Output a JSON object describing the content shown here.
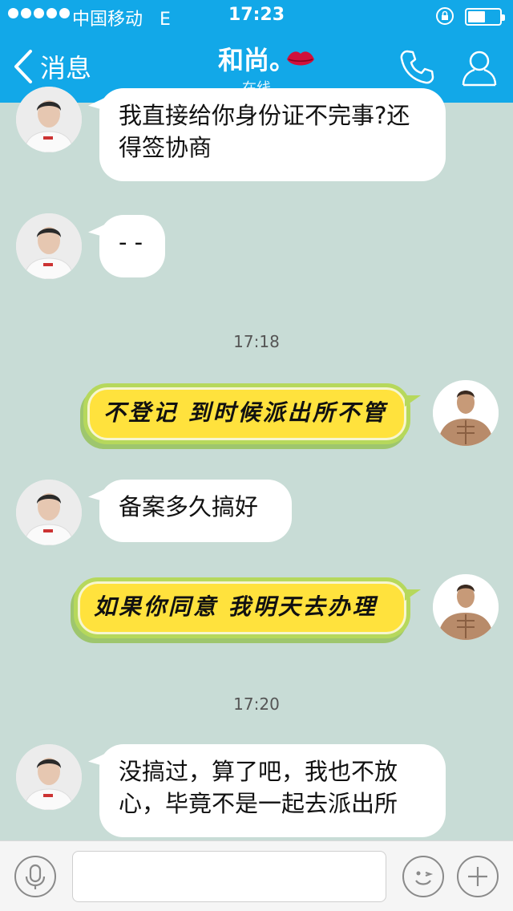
{
  "status_bar": {
    "carrier": "中国移动",
    "network": "E",
    "time": "17:23",
    "battery_level": 0.55
  },
  "nav": {
    "back_label": "消息",
    "title": "和尚。",
    "subtitle": "在线"
  },
  "messages": [
    {
      "from": "contact",
      "text": "我直接给你身份证不完事?还得签协商"
    },
    {
      "from": "contact",
      "text": "- -"
    },
    {
      "type": "timestamp",
      "text": "17:18"
    },
    {
      "from": "me",
      "text": "不登记 到时候派出所不管"
    },
    {
      "from": "contact",
      "text": "备案多久搞好"
    },
    {
      "from": "me",
      "text": "如果你同意 我明天去办理"
    },
    {
      "type": "timestamp",
      "text": "17:20"
    },
    {
      "from": "contact",
      "text": "没搞过，算了吧，我也不放心，毕竟不是一起去派出所"
    }
  ],
  "input": {
    "placeholder": "",
    "value": ""
  },
  "colors": {
    "nav_bg": "#12a8e8",
    "chat_bg": "#c8dcd6",
    "bubble_yellow": "#ffe23d",
    "bubble_border": "#b6d85c"
  },
  "icons": [
    "back-chevron-icon",
    "lips-kiss-icon",
    "phone-icon",
    "contact-person-icon",
    "microphone-icon",
    "emoji-face-icon",
    "plus-icon"
  ]
}
